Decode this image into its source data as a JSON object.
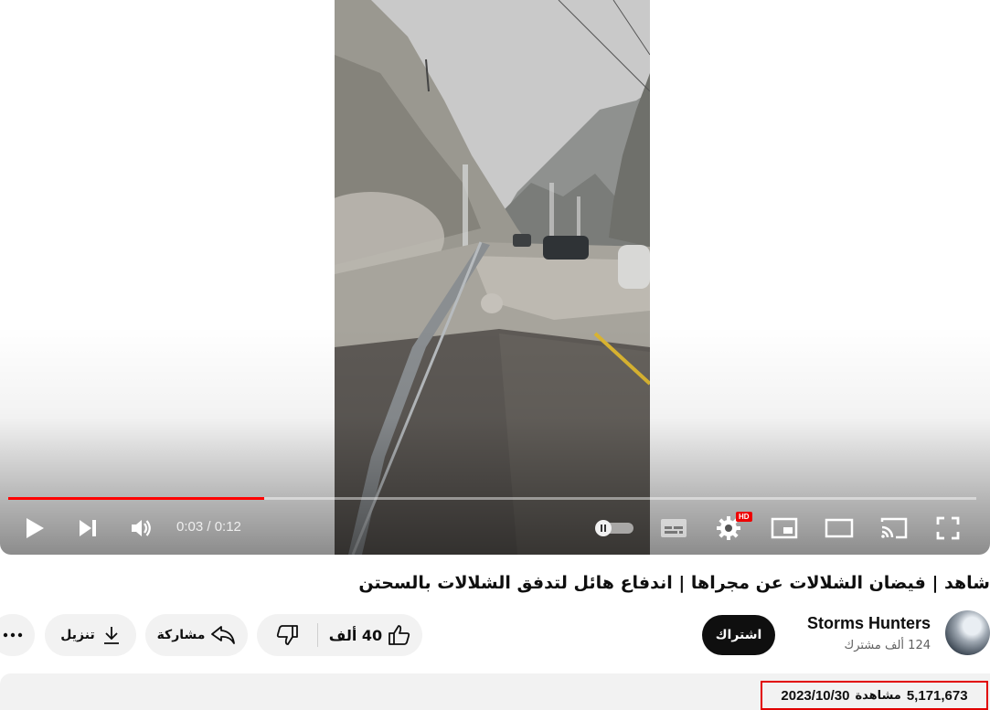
{
  "player": {
    "current_time": "0:03",
    "duration": "0:12",
    "time_display": "0:03 / 0:12",
    "progress_fraction": 0.264,
    "hd_badge": "HD",
    "accent_color": "#ff0000"
  },
  "video": {
    "title": "شاهد | فيضان الشلالات عن مجراها | اندفاع هائل لتدفق الشلالات بالسحتن"
  },
  "channel": {
    "name": "Storms Hunters",
    "subscribers": "124 ألف مشترك",
    "subscribe_label": "اشتراك"
  },
  "actions": {
    "like_count": "40 ألف",
    "share_label": "مشاركة",
    "download_label": "تنزيل",
    "more_label": "···"
  },
  "meta": {
    "views": "5,171,673",
    "views_label": "مشاهدة",
    "date": "2023/10/30"
  },
  "icons": [
    "play-icon",
    "next-icon",
    "volume-icon",
    "autoplay-toggle",
    "subtitles-icon",
    "settings-icon",
    "miniplayer-icon",
    "theater-icon",
    "cast-icon",
    "fullscreen-icon",
    "like-icon",
    "dislike-icon",
    "share-icon",
    "download-icon",
    "more-icon"
  ]
}
